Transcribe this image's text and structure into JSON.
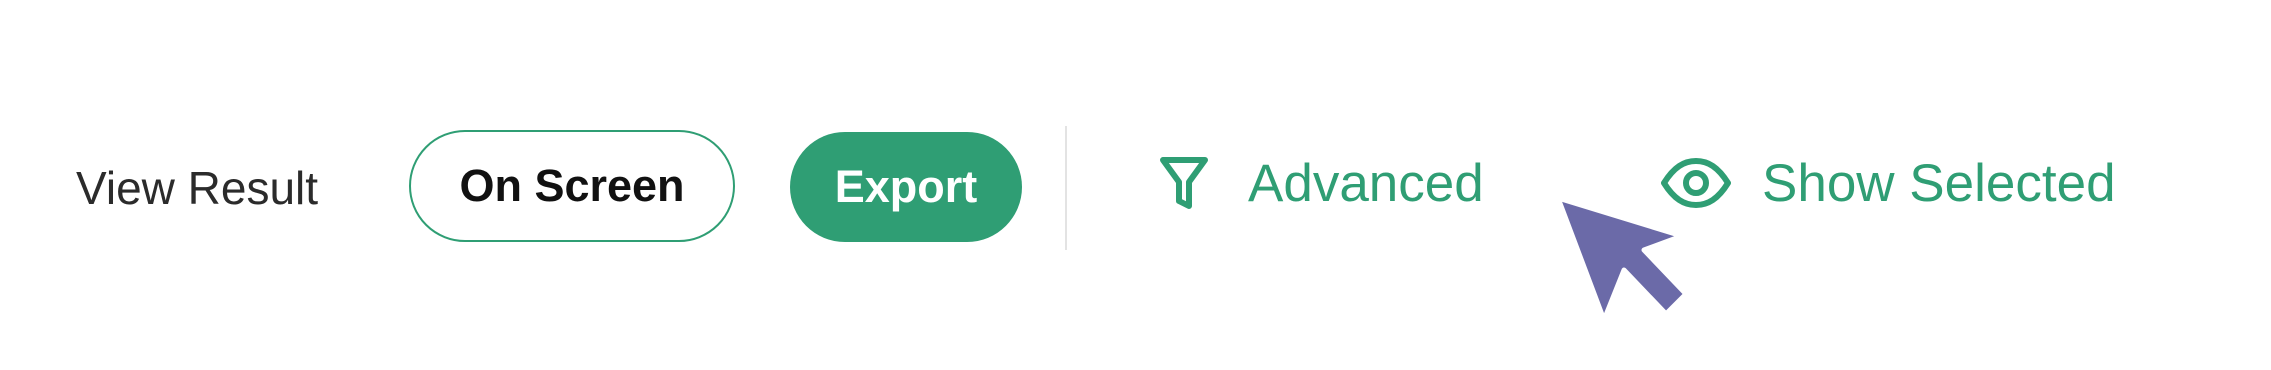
{
  "toolbar": {
    "view_result_label": "View Result",
    "on_screen_label": "On Screen",
    "export_label": "Export",
    "advanced_label": "Advanced",
    "show_selected_label": "Show Selected"
  },
  "icons": {
    "advanced": "filter-icon",
    "show_selected": "eye-icon",
    "cursor": "mouse-pointer-icon"
  },
  "colors": {
    "accent": "#2f9e74",
    "text_dark": "#2b2b2b",
    "cursor": "#6b6aa8",
    "divider": "#e3e3e3"
  }
}
